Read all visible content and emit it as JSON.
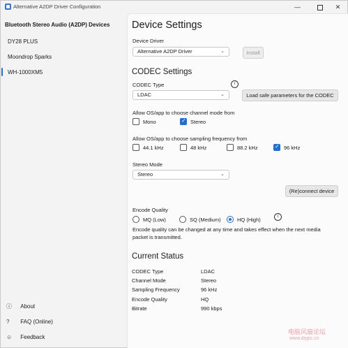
{
  "window": {
    "title": "Alternative A2DP Driver Configuration",
    "controls": {
      "minimize": "—",
      "close": "✕"
    }
  },
  "sidebar": {
    "header": "Bluetooth Stereo Audio (A2DP) Devices",
    "items": [
      {
        "label": "DY28 PLUS"
      },
      {
        "label": "Moondrop Sparks"
      },
      {
        "label": "WH-1000XM5"
      }
    ],
    "bottom": [
      {
        "icon": "info-icon",
        "glyph": "ⓘ",
        "label": "About"
      },
      {
        "icon": "question-icon",
        "glyph": "?",
        "label": "FAQ (Online)"
      },
      {
        "icon": "feedback-icon",
        "glyph": "☺",
        "label": "Feedback"
      }
    ]
  },
  "device_settings": {
    "title": "Device Settings",
    "driver_label": "Device Driver",
    "driver_value": "Alternative A2DP Driver",
    "install_label": "Install"
  },
  "codec_settings": {
    "title": "CODEC Settings",
    "codec_type_label": "CODEC Type",
    "codec_value": "LDAC",
    "load_params_label": "Load safe parameters for the CODEC",
    "channel_mode_label": "Allow OS/app to choose channel mode from",
    "channel_modes": [
      {
        "label": "Mono",
        "checked": false
      },
      {
        "label": "Stereo",
        "checked": true
      }
    ],
    "freq_label": "Allow OS/app to choose sampling frequency from",
    "frequencies": [
      {
        "label": "44.1 kHz",
        "checked": false
      },
      {
        "label": "48 kHz",
        "checked": false
      },
      {
        "label": "88.2 kHz",
        "checked": false
      },
      {
        "label": "96 kHz",
        "checked": true
      }
    ],
    "stereo_mode_label": "Stereo Mode",
    "stereo_mode_value": "Stereo",
    "reconnect_label": "(Re)connect device",
    "encode_quality_label": "Encode Quality",
    "qualities": [
      {
        "label": "MQ (Low)",
        "checked": false
      },
      {
        "label": "SQ (Medium)",
        "checked": false
      },
      {
        "label": "HQ (High)",
        "checked": true
      }
    ],
    "note_line1": "Encode quality can be changed at any time and takes effect when the next media",
    "note_line2": "packet is transmitted."
  },
  "current_status": {
    "title": "Current Status",
    "rows": [
      {
        "key": "CODEC Type",
        "value": "LDAC"
      },
      {
        "key": "Channel Mode",
        "value": "Stereo"
      },
      {
        "key": "Sampling Frequency",
        "value": "96 kHz"
      },
      {
        "key": "Encode Quality",
        "value": "HQ"
      },
      {
        "key": "Bitrate",
        "value": "990 kbps"
      }
    ]
  },
  "watermark": {
    "line1": "电脑风扇论坛",
    "line2": "www.diypc.cn"
  },
  "colors": {
    "accent": "#1f6fd1",
    "sidebar_bg": "#f3f3f3",
    "content_bg": "#fbfbfb"
  }
}
